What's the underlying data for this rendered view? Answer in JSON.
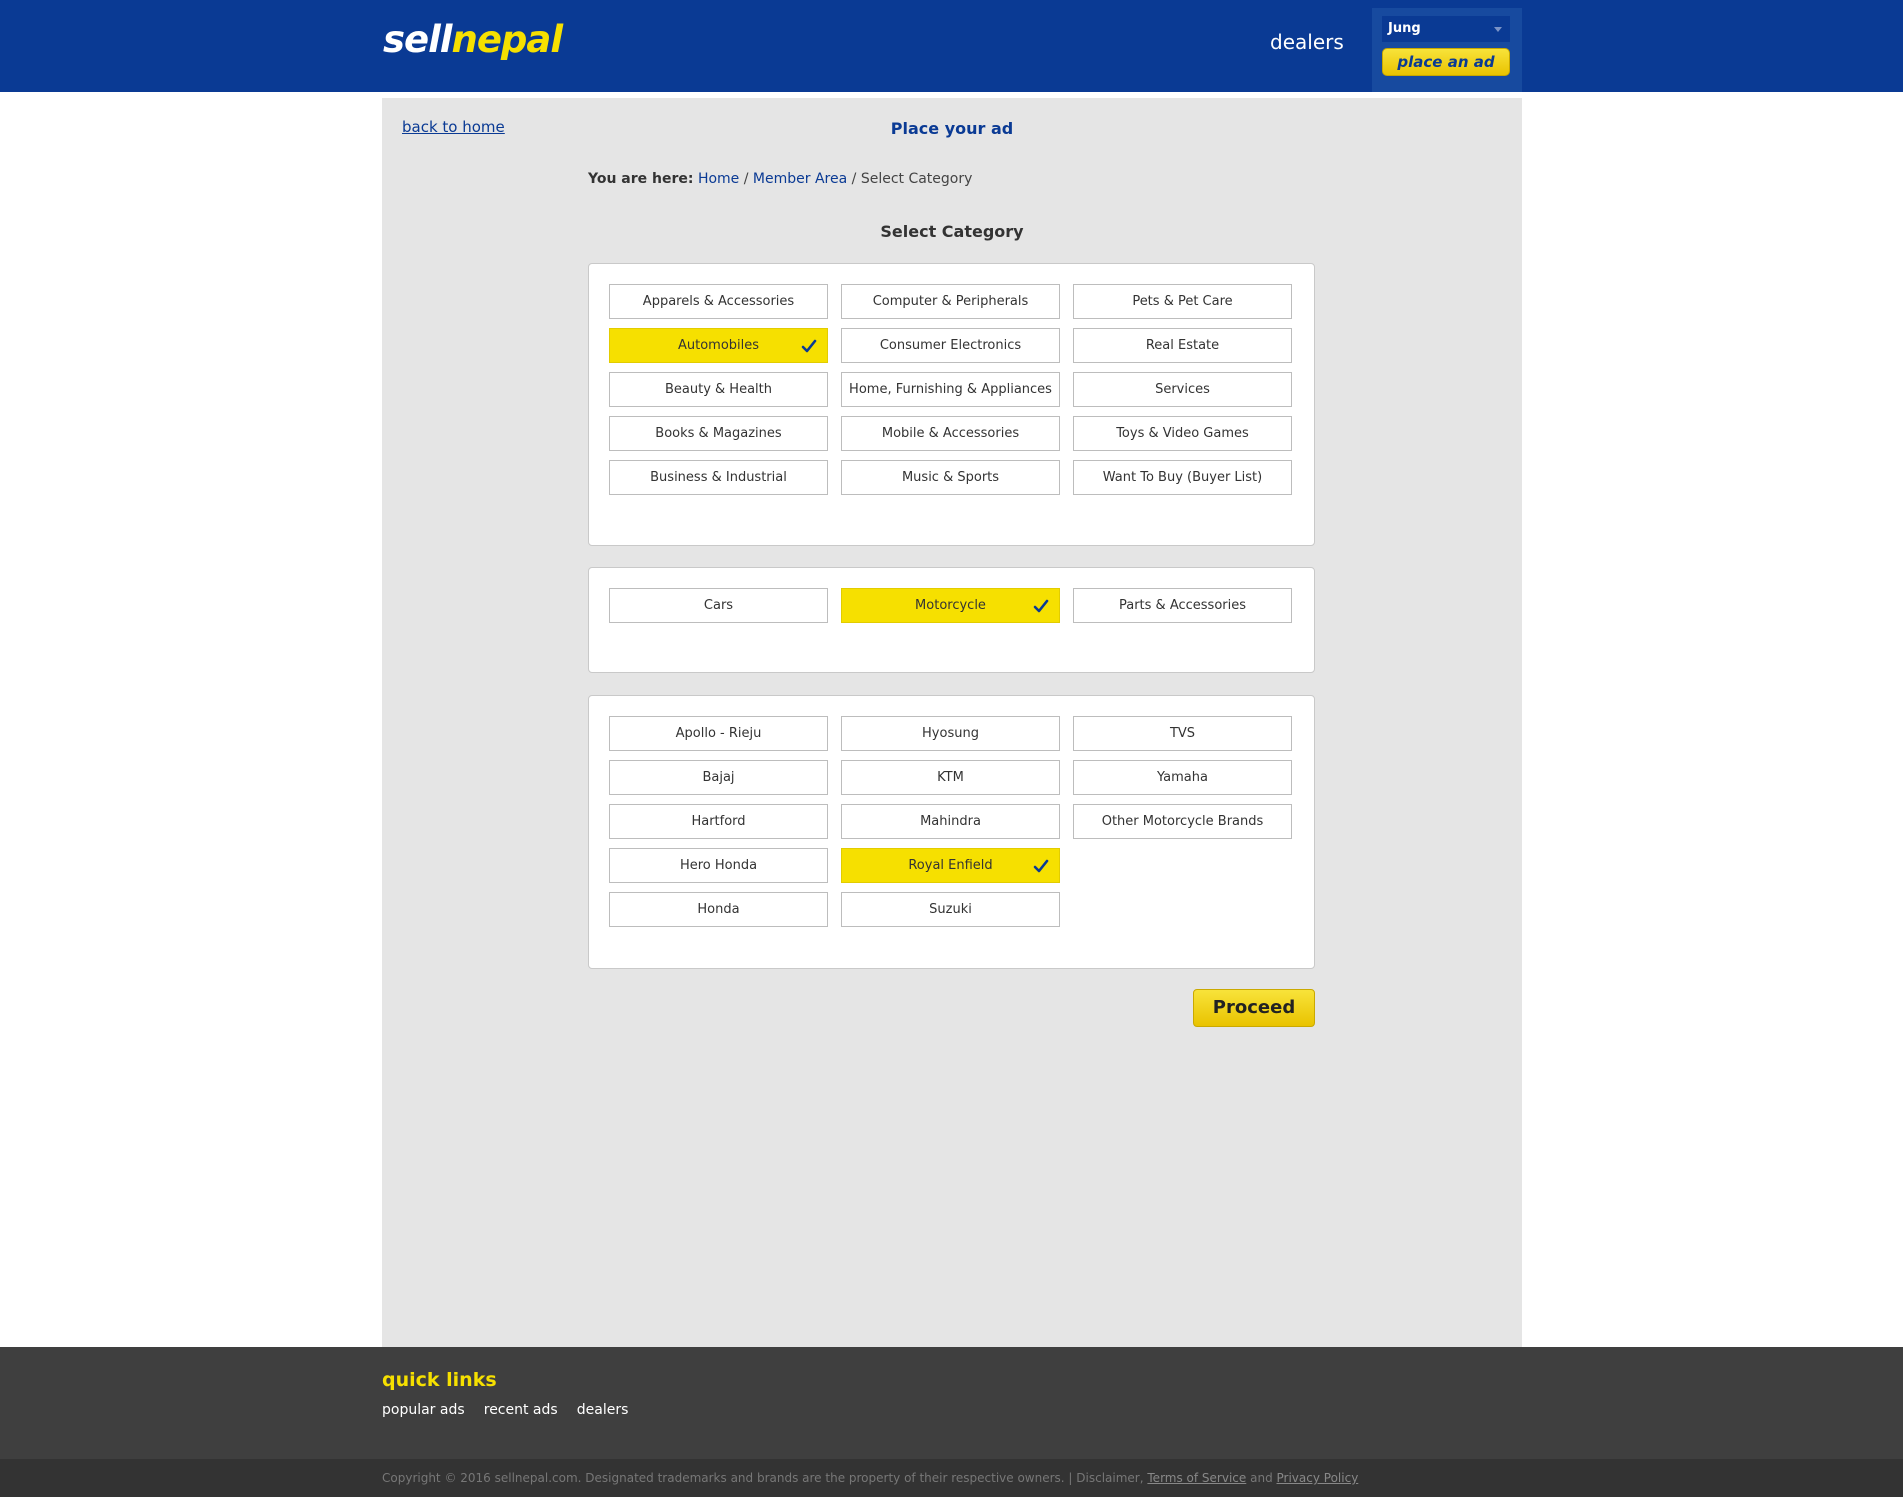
{
  "header": {
    "logo_part1": "sell",
    "logo_part2": "nepal",
    "nav_dealers": "dealers",
    "user_name": "Jung",
    "place_ad_label": "place an ad"
  },
  "main": {
    "back_home": "back to home",
    "page_title": "Place your ad",
    "breadcrumb": {
      "label": "You are here:",
      "home": "Home",
      "sep": "/",
      "member_area": "Member Area",
      "current": "Select Category"
    },
    "select_category_title": "Select Category",
    "categories": [
      {
        "label": "Apparels & Accessories",
        "selected": false
      },
      {
        "label": "Computer & Peripherals",
        "selected": false
      },
      {
        "label": "Pets & Pet Care",
        "selected": false
      },
      {
        "label": "Automobiles",
        "selected": true
      },
      {
        "label": "Consumer Electronics",
        "selected": false
      },
      {
        "label": "Real Estate",
        "selected": false
      },
      {
        "label": "Beauty & Health",
        "selected": false
      },
      {
        "label": "Home, Furnishing & Appliances",
        "selected": false
      },
      {
        "label": "Services",
        "selected": false
      },
      {
        "label": "Books & Magazines",
        "selected": false
      },
      {
        "label": "Mobile & Accessories",
        "selected": false
      },
      {
        "label": "Toys & Video Games",
        "selected": false
      },
      {
        "label": "Business & Industrial",
        "selected": false
      },
      {
        "label": "Music & Sports",
        "selected": false
      },
      {
        "label": "Want To Buy (Buyer List)",
        "selected": false
      }
    ],
    "subcategories": [
      {
        "label": "Cars",
        "selected": false
      },
      {
        "label": "Motorcycle",
        "selected": true
      },
      {
        "label": "Parts & Accessories",
        "selected": false
      }
    ],
    "brands": [
      {
        "label": "Apollo - Rieju",
        "selected": false
      },
      {
        "label": "Hyosung",
        "selected": false
      },
      {
        "label": "TVS",
        "selected": false
      },
      {
        "label": "Bajaj",
        "selected": false
      },
      {
        "label": "KTM",
        "selected": false
      },
      {
        "label": "Yamaha",
        "selected": false
      },
      {
        "label": "Hartford",
        "selected": false
      },
      {
        "label": "Mahindra",
        "selected": false
      },
      {
        "label": "Other Motorcycle Brands",
        "selected": false
      },
      {
        "label": "Hero Honda",
        "selected": false
      },
      {
        "label": "Royal Enfield",
        "selected": true
      },
      null,
      {
        "label": "Honda",
        "selected": false
      },
      {
        "label": "Suzuki",
        "selected": false
      }
    ],
    "proceed_label": "Proceed"
  },
  "footer": {
    "quick_links_title": "quick links",
    "links": [
      "popular ads",
      "recent ads",
      "dealers"
    ],
    "copyright_text": "Copyright © 2016 sellnepal.com. Designated trademarks and brands are the property of their respective owners. | Disclaimer,",
    "terms": "Terms of Service",
    "and": "and",
    "privacy": "Privacy Policy"
  },
  "colors": {
    "brand_blue": "#0a3a94",
    "brand_yellow": "#f6e000",
    "panel_grey": "#e5e5e5",
    "footer_dark": "#3f3f3f"
  }
}
